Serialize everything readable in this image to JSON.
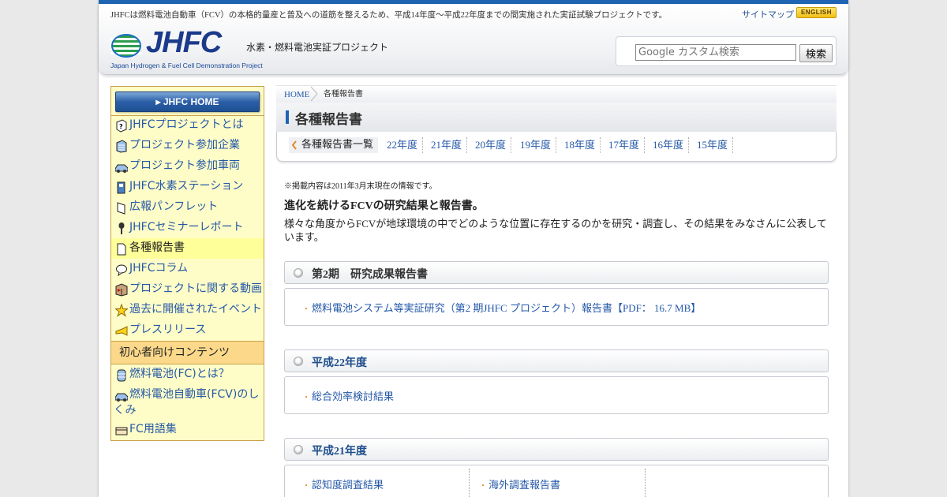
{
  "header": {
    "tagline": "JHFCは燃料電池自動車（FCV）の本格的量産と普及への道筋を整えるため、平成14年度～平成22年度までの間実施された実証試験プロジェクトです。",
    "sitemap": "サイトマップ",
    "english": "ENGLISH",
    "logo_text": "JHFC",
    "logo_sub": "Japan Hydrogen & Fuel Cell Demonstration Project",
    "project_name": "水素・燃料電池実証プロジェクト",
    "search_placeholder": "Google カスタム検索",
    "search_button": "検索",
    "colors": {
      "topbar": "#1f64b3",
      "logo": "#1b3a8c"
    }
  },
  "sidebar": {
    "home": "▸ JHFC HOME",
    "items": [
      {
        "label": "JHFCプロジェクトとは",
        "icon": "question-box-icon"
      },
      {
        "label": "プロジェクト参加企業",
        "icon": "building-icon"
      },
      {
        "label": "プロジェクト参加車両",
        "icon": "car-icon"
      },
      {
        "label": "JHFC水素ステーション",
        "icon": "station-icon"
      },
      {
        "label": "広報パンフレット",
        "icon": "pamphlet-icon"
      },
      {
        "label": "JHFCセミナーレポート",
        "icon": "microphone-icon"
      },
      {
        "label": "各種報告書",
        "icon": "document-icon",
        "active": true
      },
      {
        "label": "JHFCコラム",
        "icon": "speech-bubble-icon"
      },
      {
        "label": "プロジェクトに関する動画",
        "icon": "video-box-icon"
      },
      {
        "label": "過去に開催されたイベント",
        "icon": "star-icon"
      },
      {
        "label": "プレスリリース",
        "icon": "megaphone-icon"
      }
    ],
    "beginner_heading": "初心者向けコンテンツ",
    "beginner_items": [
      {
        "label": "燃料電池(FC)とは？",
        "icon": "battery-icon"
      },
      {
        "label": "燃料電池自動車(FCV)のしくみ",
        "icon": "car-icon"
      },
      {
        "label": "FC用語集",
        "icon": "book-icon"
      }
    ]
  },
  "breadcrumb": {
    "home": "HOME",
    "current": "各種報告書"
  },
  "page_title": "各種報告書",
  "tabs": {
    "active": "各種報告書一覧",
    "years": [
      "22年度",
      "21年度",
      "20年度",
      "19年度",
      "18年度",
      "17年度",
      "16年度",
      "15年度"
    ]
  },
  "content": {
    "note": "※掲載内容は2011年3月末現在の情報です。",
    "lead": "進化を続けるFCVの研究結果と報告書。",
    "description": "様々な角度からFCVが地球環境の中でどのような位置に存在するのかを研究・調査し、その結果をみなさんに公表しています。",
    "sections": [
      {
        "title": "第2期　研究成果報告書",
        "title_color": "#333333",
        "links": [
          "燃料電池システム等実証研究（第2 期JHFC プロジェクト）報告書【PDF： 16.7 MB】"
        ]
      },
      {
        "title": "平成22年度",
        "title_color": "#1f4e8c",
        "links": [
          "総合効率検討結果"
        ]
      },
      {
        "title": "平成21年度",
        "title_color": "#1f4e8c",
        "links": [
          "認知度調査結果",
          "海外調査報告書"
        ]
      }
    ]
  }
}
